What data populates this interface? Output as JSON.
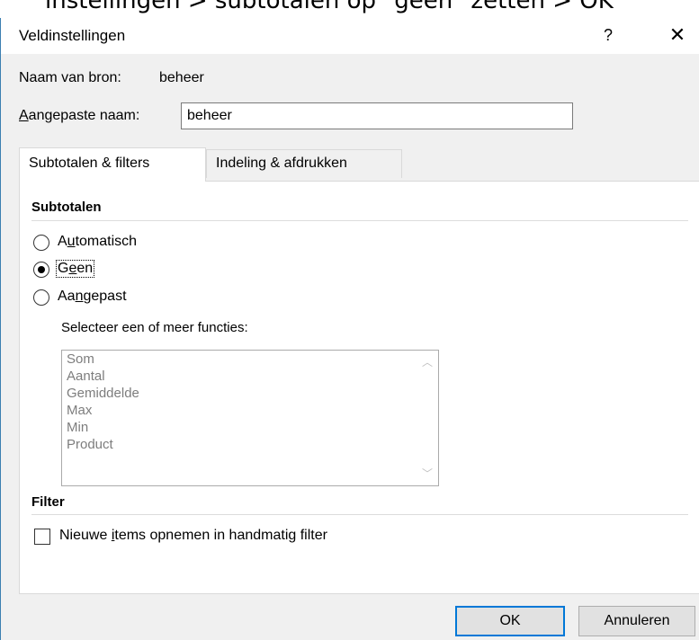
{
  "caption": "instellingen > subtotalen op \"geen\" zetten > OK",
  "dialog": {
    "title": "Veldinstellingen",
    "help_glyph": "?",
    "close_glyph": "✕"
  },
  "source_name": {
    "label": "Naam van bron:",
    "value": "beheer"
  },
  "custom_name": {
    "label_prefix": "A",
    "label_rest": "angepaste naam:",
    "value": "beheer"
  },
  "tabs": [
    {
      "label": "Subtotalen & filters",
      "active": true
    },
    {
      "label": "Indeling & afdrukken",
      "active": false
    }
  ],
  "subtotals": {
    "section_title": "Subtotalen",
    "options": [
      {
        "pre": "A",
        "key": "u",
        "post": "tomatisch",
        "selected": false
      },
      {
        "pre": "G",
        "key": "e",
        "post": "en",
        "selected": true
      },
      {
        "pre": "Aa",
        "key": "n",
        "post": "gepast",
        "selected": false
      }
    ],
    "functions_label": "Selecteer een of meer functies:",
    "functions": [
      "Som",
      "Aantal",
      "Gemiddelde",
      "Max",
      "Min",
      "Product"
    ]
  },
  "filter": {
    "section_title": "Filter",
    "checkbox_pre": "Nieuwe ",
    "checkbox_key": "i",
    "checkbox_post": "tems opnemen in handmatig filter",
    "checked": false
  },
  "buttons": {
    "ok": "OK",
    "cancel": "Annuleren"
  }
}
